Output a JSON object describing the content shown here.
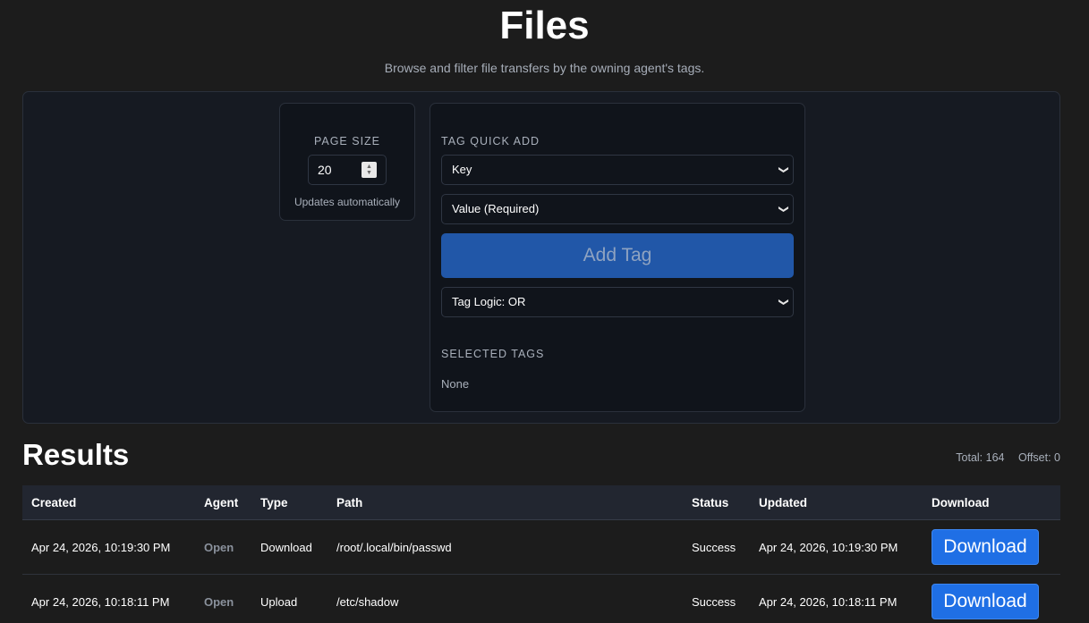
{
  "header": {
    "title": "Files",
    "subtitle": "Browse and filter file transfers by the owning agent's tags."
  },
  "page_size": {
    "label": "PAGE SIZE",
    "value": "20",
    "note": "Updates automatically"
  },
  "tag_quick_add": {
    "label": "TAG QUICK ADD",
    "key_select": "Key",
    "value_select": "Value (Required)",
    "add_button": "Add Tag",
    "logic_select": "Tag Logic: OR",
    "selected_label": "SELECTED TAGS",
    "selected_value": "None"
  },
  "results": {
    "title": "Results",
    "total": "Total: 164",
    "offset": "Offset: 0",
    "columns": [
      "Created",
      "Agent",
      "Type",
      "Path",
      "Status",
      "Updated",
      "Download"
    ],
    "rows": [
      {
        "created": "Apr 24, 2026, 10:19:30 PM",
        "agent": "Open",
        "type": "Download",
        "path": "/root/.local/bin/passwd",
        "status": "Success",
        "updated": "Apr 24, 2026, 10:19:30 PM",
        "download": "Download"
      },
      {
        "created": "Apr 24, 2026, 10:18:11 PM",
        "agent": "Open",
        "type": "Upload",
        "path": "/etc/shadow",
        "status": "Success",
        "updated": "Apr 24, 2026, 10:18:11 PM",
        "download": "Download"
      }
    ]
  },
  "colors": {
    "background": "#1c1c1c",
    "panel": "#161a22",
    "add_button": "#2157a8",
    "download_button": "#1f6fe5"
  },
  "icons": {
    "select_chevron": "chevron-down-icon",
    "number_spinner": "spinner-icon"
  }
}
